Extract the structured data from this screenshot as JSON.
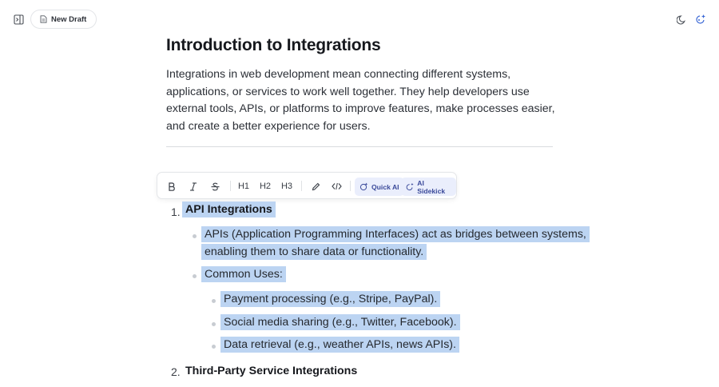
{
  "topbar": {
    "sidebar_icon": "sidebar-toggle-icon",
    "new_draft_label": "New Draft",
    "theme_icon": "moon-icon",
    "ai_icon": "ai-sparkle-icon"
  },
  "document": {
    "title": "Introduction to Integrations",
    "intro": "Integrations in web development mean connecting different systems, applications, or services to work well together. They help developers use external tools, APIs, or platforms to improve features, make processes easier, and create a better experience for users.",
    "list": {
      "item1_number": "1.",
      "item1_title": "API Integrations",
      "bullet1_line1": "APIs (Application Programming Interfaces) act as bridges between systems,",
      "bullet1_line2": "enabling them to share data or functionality.",
      "bullet2": "Common Uses:",
      "sub1": "Payment processing (e.g., Stripe, PayPal).",
      "sub2": "Social media sharing (e.g., Twitter, Facebook).",
      "sub3": "Data retrieval (e.g., weather APIs, news APIs).",
      "item2_number": "2.",
      "item2_title": "Third-Party Service Integrations"
    }
  },
  "toolbar": {
    "bold_icon": "bold-icon",
    "italic_icon": "italic-icon",
    "strike_icon": "strikethrough-icon",
    "h1": "H1",
    "h2": "H2",
    "h3": "H3",
    "highlight_icon": "pencil-icon",
    "code_icon": "code-icon",
    "quick_ai_label": "Quick AI",
    "ai_sidekick_label": "AI Sidekick"
  },
  "colors": {
    "selection": "#bcd4f2",
    "ai_button_bg": "#eaeefc",
    "accent": "#3b4a9a"
  }
}
